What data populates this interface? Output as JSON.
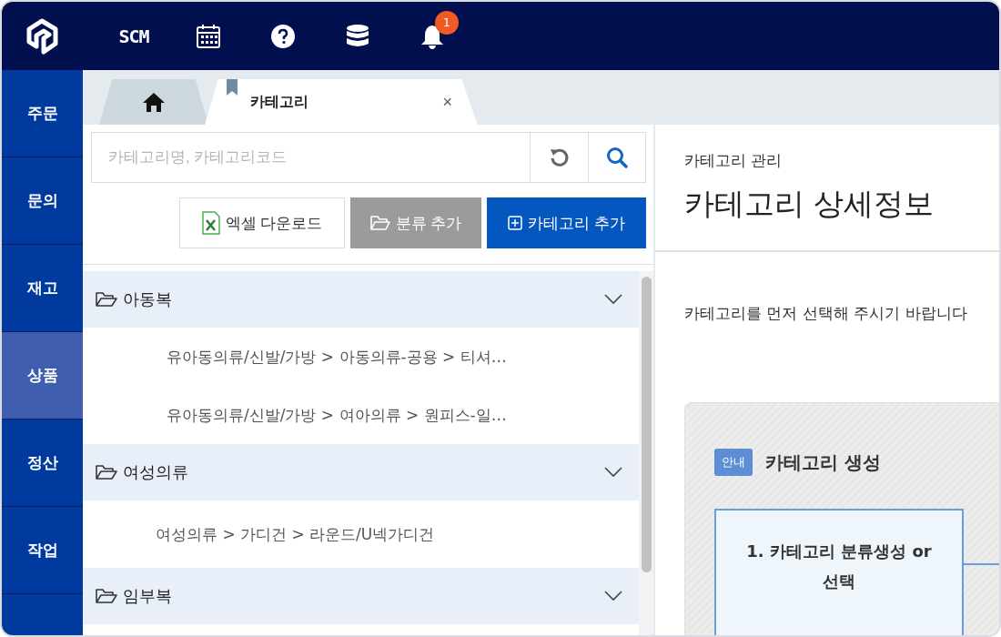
{
  "topbar": {
    "brand": "SCM",
    "notification_count": "1"
  },
  "sidebar": {
    "items": [
      {
        "label": "주문",
        "selected": false
      },
      {
        "label": "문의",
        "selected": false
      },
      {
        "label": "재고",
        "selected": false
      },
      {
        "label": "상품",
        "selected": true
      },
      {
        "label": "정산",
        "selected": false
      },
      {
        "label": "작업",
        "selected": false
      }
    ]
  },
  "tabs": [
    {
      "kind": "home",
      "selected": false
    },
    {
      "kind": "page",
      "label": "카테고리",
      "close": "×",
      "pinned": true,
      "selected": true
    }
  ],
  "search": {
    "placeholder": "카테고리명, 카테고리코드"
  },
  "actions": [
    {
      "kind": "excel",
      "label": "엑셀 다운로드"
    },
    {
      "kind": "folder",
      "label": "분류 추가"
    },
    {
      "kind": "add",
      "label": "카테고리 추가"
    }
  ],
  "categories": [
    {
      "name": "아동복",
      "children": [
        {
          "name": "유아동의류/신발/가방 > 아동의류-공용 > 티셔…"
        },
        {
          "name": "유아동의류/신발/가방 > 여아의류 > 원피스-일…"
        }
      ]
    },
    {
      "name": "여성의류",
      "children": [
        {
          "name": "여성의류 > 가디건 > 라운드/U넥가디건"
        }
      ]
    },
    {
      "name": "임부복"
    }
  ],
  "detail": {
    "breadcrumb": "카테고리 관리",
    "title": "카테고리 상세정보",
    "message": "카테고리를 먼저 선택해 주시기 바랍니다",
    "guide": {
      "badge": "안내",
      "title": "카테고리 생성",
      "steps": [
        "1. 카테고리 분류생성 or 선택"
      ]
    }
  }
}
